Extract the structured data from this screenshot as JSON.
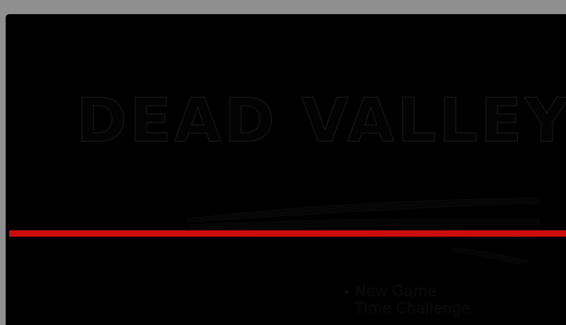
{
  "game": {
    "title": "DEAD VALLEY"
  },
  "menu": {
    "selected_index": 0,
    "items": [
      {
        "label": "New Game"
      },
      {
        "label": "Time Challenge"
      }
    ]
  },
  "colors": {
    "background": "#000000",
    "accent_line": "#cc0d0d",
    "title_outline": "#151515",
    "desktop": "#8f8f8f"
  },
  "icons": {
    "menu_cursor": "triangle-right-icon"
  }
}
